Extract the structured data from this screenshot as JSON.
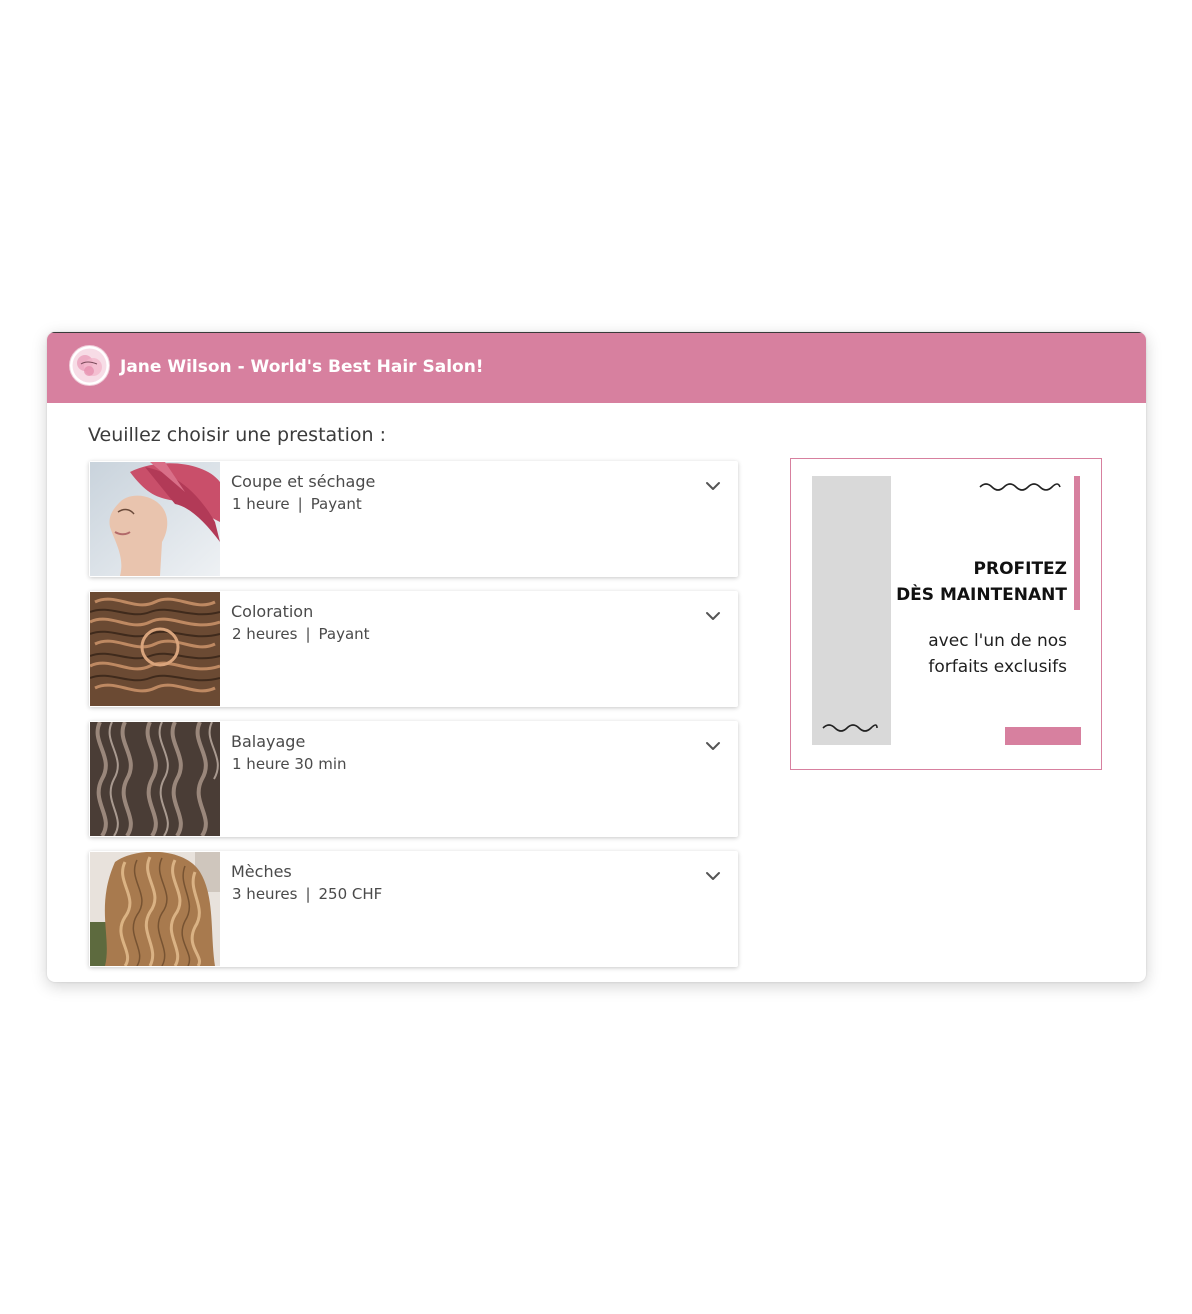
{
  "header": {
    "title": "Jane Wilson - World's Best Hair Salon!",
    "color": "#d7809f"
  },
  "main": {
    "prompt": "Veuillez choisir une prestation :"
  },
  "services": [
    {
      "name": "Coupe et séchage",
      "duration": "1 heure",
      "price": "Payant",
      "icon": "chevron-down-icon"
    },
    {
      "name": "Coloration",
      "duration": "2 heures",
      "price": "Payant",
      "icon": "chevron-down-icon"
    },
    {
      "name": "Balayage",
      "duration": "1 heure 30 min",
      "icon": "chevron-down-icon"
    },
    {
      "name": "Mèches",
      "duration": "3 heures",
      "price": "250 CHF",
      "icon": "chevron-down-icon"
    }
  ],
  "promo": {
    "headline_line1": "PROFITEZ",
    "headline_line2": "DÈS MAINTENANT",
    "sub_line1": "avec l'un de nos",
    "sub_line2": "forfaits exclusifs",
    "accent": "#d7809f"
  }
}
